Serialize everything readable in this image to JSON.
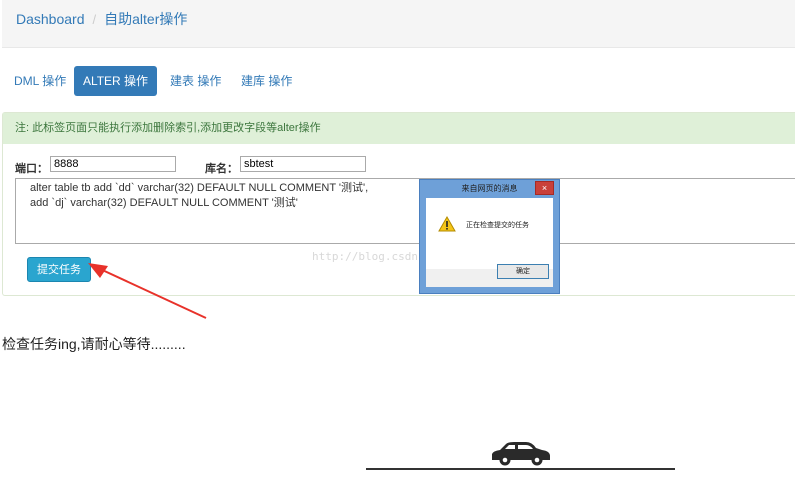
{
  "breadcrumb": {
    "home": "Dashboard",
    "separator": "/",
    "current": "自助alter操作"
  },
  "tabs": [
    {
      "label": "DML 操作",
      "active": false
    },
    {
      "label": "ALTER 操作",
      "active": true
    },
    {
      "label": "建表 操作",
      "active": false
    },
    {
      "label": "建库 操作",
      "active": false
    }
  ],
  "form": {
    "notice": "注: 此标签页面只能执行添加删除索引,添加更改字段等alter操作",
    "port_label": "端口：",
    "port_value": "8888",
    "db_label": "库名：",
    "db_value": "sbtest",
    "sql_lines": [
      "alter table tb add `dd` varchar(32) DEFAULT NULL COMMENT '测试',",
      "add `dj` varchar(32) DEFAULT NULL COMMENT '测试'"
    ],
    "submit_label": "提交任务"
  },
  "watermark": "http://blog.csdn.net/liuhanran",
  "dialog": {
    "title": "来自网页的消息",
    "close_symbol": "×",
    "message": "正在检查提交的任务",
    "ok_label": "确定",
    "icon": "warning-icon"
  },
  "status": {
    "text": "检查任务ing,请耐心等待........."
  },
  "colors": {
    "primary": "#337ab7",
    "notice_bg": "#dff0d8",
    "notice_text": "#3c763d",
    "submit_bg": "#2aa5cf",
    "arrow": "#e8322a"
  }
}
